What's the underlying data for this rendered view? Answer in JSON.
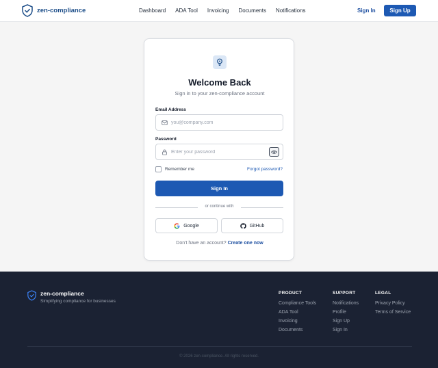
{
  "nav": {
    "brand": "zen-compliance",
    "links": [
      "Dashboard",
      "ADA Tool",
      "Invoicing",
      "Documents",
      "Notifications"
    ],
    "signin_label": "Sign In",
    "signup_label": "Sign Up"
  },
  "card": {
    "title": "Welcome Back",
    "subtitle": "Sign in to your zen-compliance account",
    "email_label": "Email Address",
    "email_placeholder": "you@company.com",
    "email_value": "",
    "password_label": "Password",
    "password_placeholder": "Enter your password",
    "password_value": "",
    "remember_label": "Remember me",
    "remember_checked": false,
    "forgot_label": "Forgot password?",
    "submit_label": "Sign In",
    "divider_text": "or continue with",
    "google_label": "Google",
    "github_label": "GitHub",
    "no_account_text": "Don't have an account?",
    "create_link": "Create one now"
  },
  "footer": {
    "brand": "zen-compliance",
    "tagline": "Simplifying compliance for businesses",
    "columns": [
      {
        "title": "PRODUCT",
        "links": [
          "Compliance Tools",
          "ADA Tool",
          "Invoicing",
          "Documents"
        ]
      },
      {
        "title": "SUPPORT",
        "links": [
          "Notifications",
          "Profile",
          "Sign Up",
          "Sign In"
        ]
      },
      {
        "title": "LEGAL",
        "links": [
          "Privacy Policy",
          "Terms of Service"
        ]
      }
    ],
    "copyright": "© 2026 zen-compliance. All rights reserved."
  },
  "colors": {
    "primary": "#1d59b3",
    "brand_text": "#1d4e89",
    "footer_bg": "#1b2233",
    "page_bg": "#f5f5f5"
  },
  "icons": {
    "brand": "shield-check-icon",
    "card": "lightbulb-icon",
    "email": "mail-icon",
    "password": "lock-icon",
    "toggle": "eye-icon",
    "google": "google-icon",
    "github": "github-icon"
  }
}
